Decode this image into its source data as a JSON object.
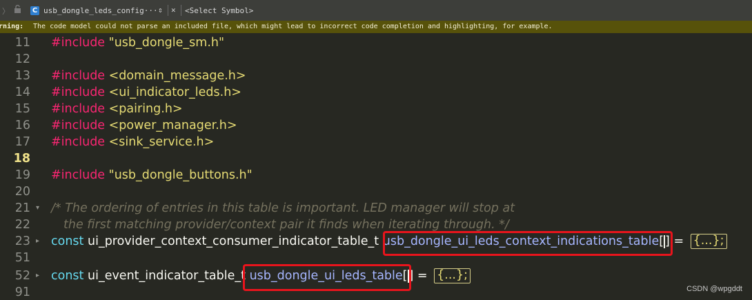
{
  "tab": {
    "nav_arrow": "〉",
    "filename": "usb_dongle_leds_config···",
    "file_icon_letter": "C",
    "switch_symbol": "⇕",
    "close_symbol": "✕",
    "symbol_selector": "<Select Symbol>"
  },
  "warning": {
    "label": "Warning:",
    "text": "The code model could not parse an included file, which might lead to incorrect code completion and highlighting, for example."
  },
  "code_lines": {
    "l11": {
      "num": "11",
      "kw": "#include",
      "arg": " \"usb_dongle_sm.h\""
    },
    "l12": {
      "num": "12"
    },
    "l13": {
      "num": "13",
      "kw": "#include",
      "arg": " <domain_message.h>"
    },
    "l14": {
      "num": "14",
      "kw": "#include",
      "arg": " <ui_indicator_leds.h>"
    },
    "l15": {
      "num": "15",
      "kw": "#include",
      "arg": " <pairing.h>"
    },
    "l16": {
      "num": "16",
      "kw": "#include",
      "arg": " <power_manager.h>"
    },
    "l17": {
      "num": "17",
      "kw": "#include",
      "arg": " <sink_service.h>"
    },
    "l18": {
      "num": "18"
    },
    "l19": {
      "num": "19",
      "kw": "#include",
      "arg": " \"usb_dongle_buttons.h\""
    },
    "l20": {
      "num": "20"
    },
    "l21": {
      "num": "21",
      "text": "/* The ordering of entries in this table is important. LED manager will stop at"
    },
    "l22": {
      "num": "22",
      "text": "the first matching provider/context pair it finds when iterating through. */"
    },
    "l23": {
      "num": "23",
      "kw": "const",
      "type": "ui_provider_context_consumer_indicator_table_t",
      "name": "usb_dongle_ui_leds_context_indications_table",
      "bracket_open": "[",
      "bracket_close": "]",
      "assign": " = ",
      "folded": "{...};"
    },
    "l51": {
      "num": "51"
    },
    "l52": {
      "num": "52",
      "kw": "const",
      "type": "ui_event_indicator_table_t",
      "name": "usb_dongle_ui_leds_table",
      "bracket_open": "[",
      "bracket_close": "]",
      "assign": " = ",
      "folded": "{...};"
    },
    "l91": {
      "num": "91"
    }
  },
  "fold_markers": {
    "expanded": "▾",
    "collapsed": "▸"
  },
  "watermark": "CSDN @wpgddt",
  "colors": {
    "editor_bg": "#272822",
    "warning_bg": "#57520a",
    "highlight_box": "#e8141c",
    "keyword": "#f92672",
    "string": "#e6db74",
    "comment": "#75715e"
  },
  "icons": [
    "lock-icon",
    "c-file-icon",
    "close-icon",
    "fold-arrow-icon"
  ]
}
